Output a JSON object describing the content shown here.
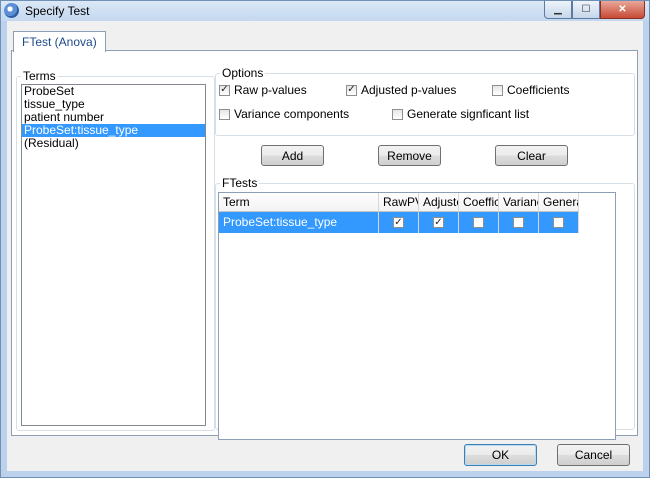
{
  "window": {
    "title": "Specify Test"
  },
  "tabs": [
    {
      "label": "FTest (Anova)"
    }
  ],
  "terms": {
    "label": "Terms",
    "items": [
      "ProbeSet",
      "tissue_type",
      "patient number",
      "ProbeSet:tissue_type",
      "(Residual)"
    ],
    "selected_index": 3
  },
  "options": {
    "label": "Options",
    "raw_pvalues": {
      "label": "Raw p-values",
      "checked": true
    },
    "adjusted_pvalues": {
      "label": "Adjusted p-values",
      "checked": true
    },
    "coefficients": {
      "label": "Coefficients",
      "checked": false
    },
    "variance_components": {
      "label": "Variance components",
      "checked": false
    },
    "generate_list": {
      "label": "Generate signficant list",
      "checked": false
    }
  },
  "buttons": {
    "add": "Add",
    "remove": "Remove",
    "clear": "Clear",
    "ok": "OK",
    "cancel": "Cancel"
  },
  "ftests": {
    "label": "FTests",
    "columns": [
      "Term",
      "RawPV",
      "Adjuste",
      "Coeffic",
      "Varianc",
      "Genera"
    ],
    "rows": [
      {
        "term": "ProbeSet:tissue_type",
        "checks": [
          true,
          true,
          false,
          false,
          false
        ]
      }
    ]
  }
}
